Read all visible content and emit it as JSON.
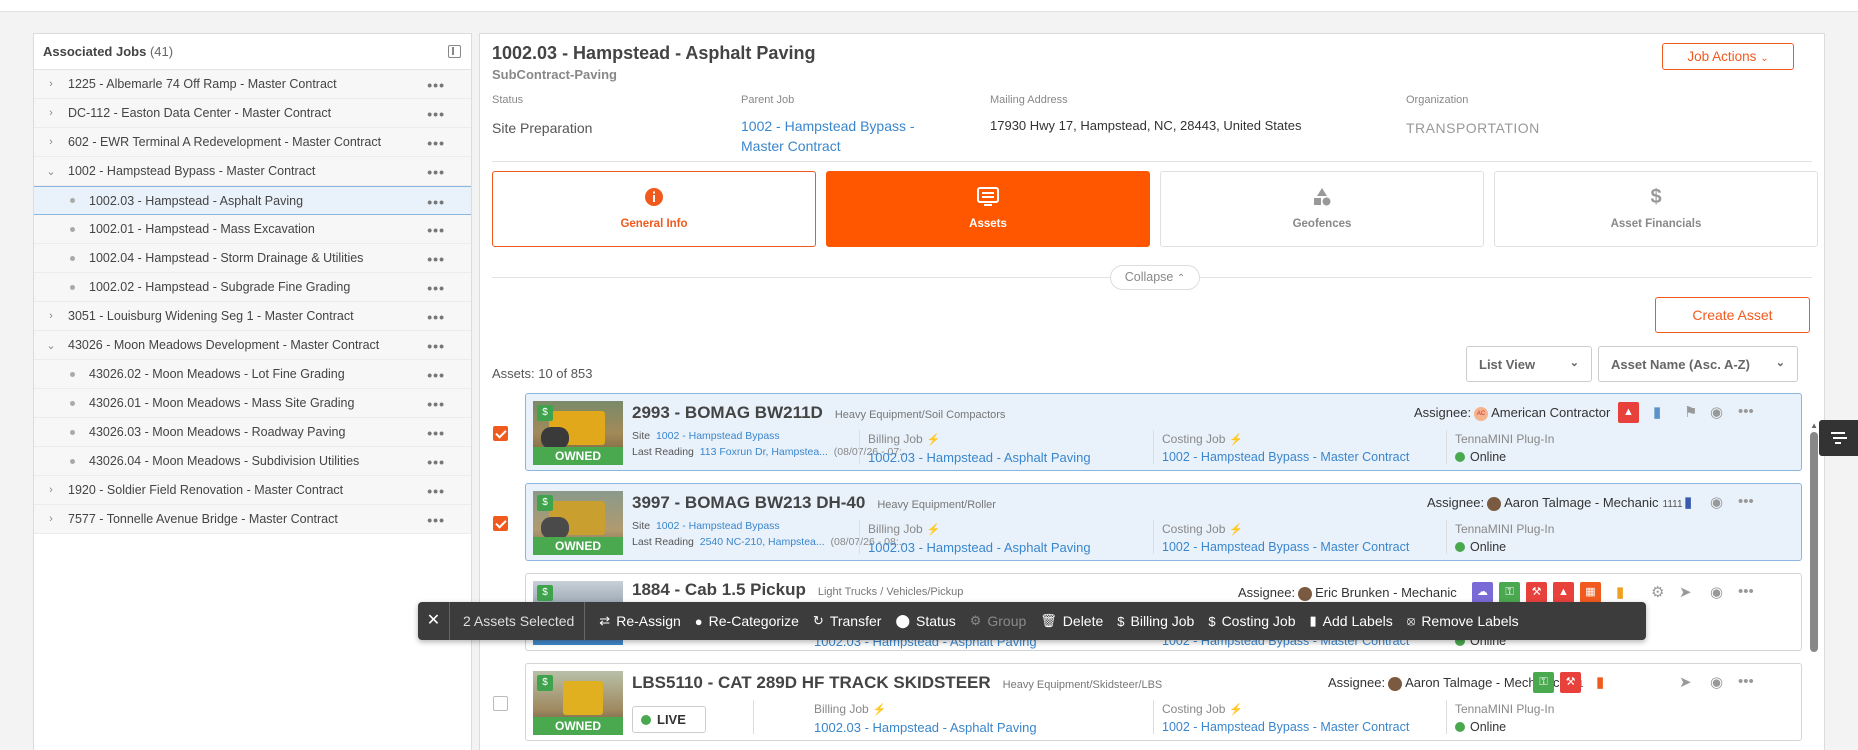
{
  "sidebar": {
    "title": "Associated Jobs",
    "count": "(41)",
    "items": [
      {
        "label": "1225 - Albemarle 74 Off Ramp - Master Contract",
        "type": "parent",
        "caret": ">"
      },
      {
        "label": "DC-112 - Easton Data Center - Master Contract",
        "type": "parent",
        "caret": ">"
      },
      {
        "label": "602 - EWR Terminal A Redevelopment - Master Contract",
        "type": "parent",
        "caret": ">"
      },
      {
        "label": "1002 - Hampstead Bypass - Master Contract",
        "type": "parent",
        "caret": "v"
      },
      {
        "label": "1002.03 - Hampstead - Asphalt Paving",
        "type": "child",
        "selected": true
      },
      {
        "label": "1002.01 - Hampstead - Mass Excavation",
        "type": "child"
      },
      {
        "label": "1002.04 - Hampstead - Storm Drainage & Utilities",
        "type": "child"
      },
      {
        "label": "1002.02 - Hampstead - Subgrade Fine Grading",
        "type": "child"
      },
      {
        "label": "3051 - Louisburg Widening Seg 1 - Master Contract",
        "type": "parent",
        "caret": ">"
      },
      {
        "label": "43026 - Moon Meadows Development - Master Contract",
        "type": "parent",
        "caret": "v"
      },
      {
        "label": "43026.02 - Moon Meadows - Lot Fine Grading",
        "type": "child"
      },
      {
        "label": "43026.01 - Moon Meadows - Mass Site Grading",
        "type": "child"
      },
      {
        "label": "43026.03 - Moon Meadows - Roadway Paving",
        "type": "child"
      },
      {
        "label": "43026.04 - Moon Meadows - Subdivision Utilities",
        "type": "child"
      },
      {
        "label": "1920 - Soldier Field Renovation - Master Contract",
        "type": "parent",
        "caret": ">"
      },
      {
        "label": "7577 - Tonnelle Avenue Bridge - Master Contract",
        "type": "parent",
        "caret": ">"
      }
    ],
    "more_glyph": "•••"
  },
  "header": {
    "title": "1002.03 - Hampstead - Asphalt Paving",
    "subtitle": "SubContract-Paving",
    "job_actions": "Job Actions",
    "status_label": "Status",
    "status_value": "Site Preparation",
    "parent_label": "Parent Job",
    "parent_value": "1002 - Hampstead Bypass - Master Contract",
    "mailing_label": "Mailing Address",
    "mailing_value": "17930 Hwy 17, Hampstead, NC, 28443, United States",
    "org_label": "Organization",
    "org_value": "TRANSPORTATION"
  },
  "tabs": [
    {
      "label": "General Info",
      "icon": "info-icon"
    },
    {
      "label": "Assets",
      "icon": "monitor-icon",
      "active": true
    },
    {
      "label": "Geofences",
      "icon": "shapes-icon"
    },
    {
      "label": "Asset Financials",
      "icon": "dollar-icon"
    }
  ],
  "collapse_label": "Collapse",
  "create_asset": "Create Asset",
  "view_select": "List View",
  "sort_select": "Asset Name (Asc. A-Z)",
  "assets_count": "Assets: 10 of 853",
  "assets": [
    {
      "name": "2993 - BOMAG BW211D",
      "category": "Heavy Equipment/Soil Compactors",
      "assignee_label": "Assignee:",
      "assignee": "American Contractor",
      "assignee_initials": "AC",
      "checked": true,
      "ownership": "OWNED",
      "site_label": "Site",
      "site": "1002 - Hampstead Bypass",
      "reading_label": "Last Reading",
      "reading": "113 Foxrun Dr, Hampstea...",
      "reading_time": "(08/07/26 - 07:...",
      "billing_label": "Billing Job",
      "billing": "1002.03 - Hampstead - Asphalt Paving",
      "costing_label": "Costing Job",
      "costing": "1002 - Hampstead Bypass - Master Contract",
      "device": "TennaMINI Plug-In",
      "device_status": "Online"
    },
    {
      "name": "3997 - BOMAG BW213 DH-40",
      "category": "Heavy Equipment/Roller",
      "assignee_label": "Assignee:",
      "assignee": "Aaron Talmage - Mechanic",
      "assignee_num": "1111",
      "checked": true,
      "ownership": "OWNED",
      "site_label": "Site",
      "site": "1002 - Hampstead Bypass",
      "reading_label": "Last Reading",
      "reading": "2540 NC-210, Hampstea...",
      "reading_time": "(08/07/26 - 08:...",
      "billing_label": "Billing Job",
      "billing": "1002.03 - Hampstead - Asphalt Paving",
      "costing_label": "Costing Job",
      "costing": "1002 - Hampstead Bypass - Master Contract",
      "device": "TennaMINI Plug-In",
      "device_status": "Online"
    },
    {
      "name": "1884 - Cab 1.5 Pickup",
      "category": "Light Trucks / Vehicles/Pickup",
      "assignee_label": "Assignee:",
      "assignee": "Eric Brunken - Mechanic",
      "checked": false,
      "billing": "1002.03 - Hampstead - Asphalt Paving",
      "costing": "1002 - Hampstead Bypass - Master Contract",
      "device_status": "Online"
    },
    {
      "name": "LBS5110 - CAT 289D HF TRACK SKIDSTEER",
      "category": "Heavy Equipment/Skidsteer/LBS",
      "assignee_label": "Assignee:",
      "assignee": "Aaron Talmage - Mechanic",
      "assignee_num": "1111",
      "checked": false,
      "ownership": "OWNED",
      "live": "LIVE",
      "billing_label": "Billing Job",
      "billing": "1002.03 - Hampstead - Asphalt Paving",
      "costing_label": "Costing Job",
      "costing": "1002 - Hampstead Bypass - Master Contract",
      "device": "TennaMINI Plug-In",
      "device_status": "Online"
    }
  ],
  "bulk_bar": {
    "selected": "2 Assets Selected",
    "actions": [
      "Re-Assign",
      "Re-Categorize",
      "Transfer",
      "Status",
      "Group",
      "Delete",
      "Billing Job",
      "Costing Job",
      "Add Labels",
      "Remove Labels"
    ]
  },
  "colors": {
    "accent": "#ff5600",
    "link": "#3a86cc",
    "online": "#4aa84f",
    "selected_bg": "#e9f2fb"
  }
}
